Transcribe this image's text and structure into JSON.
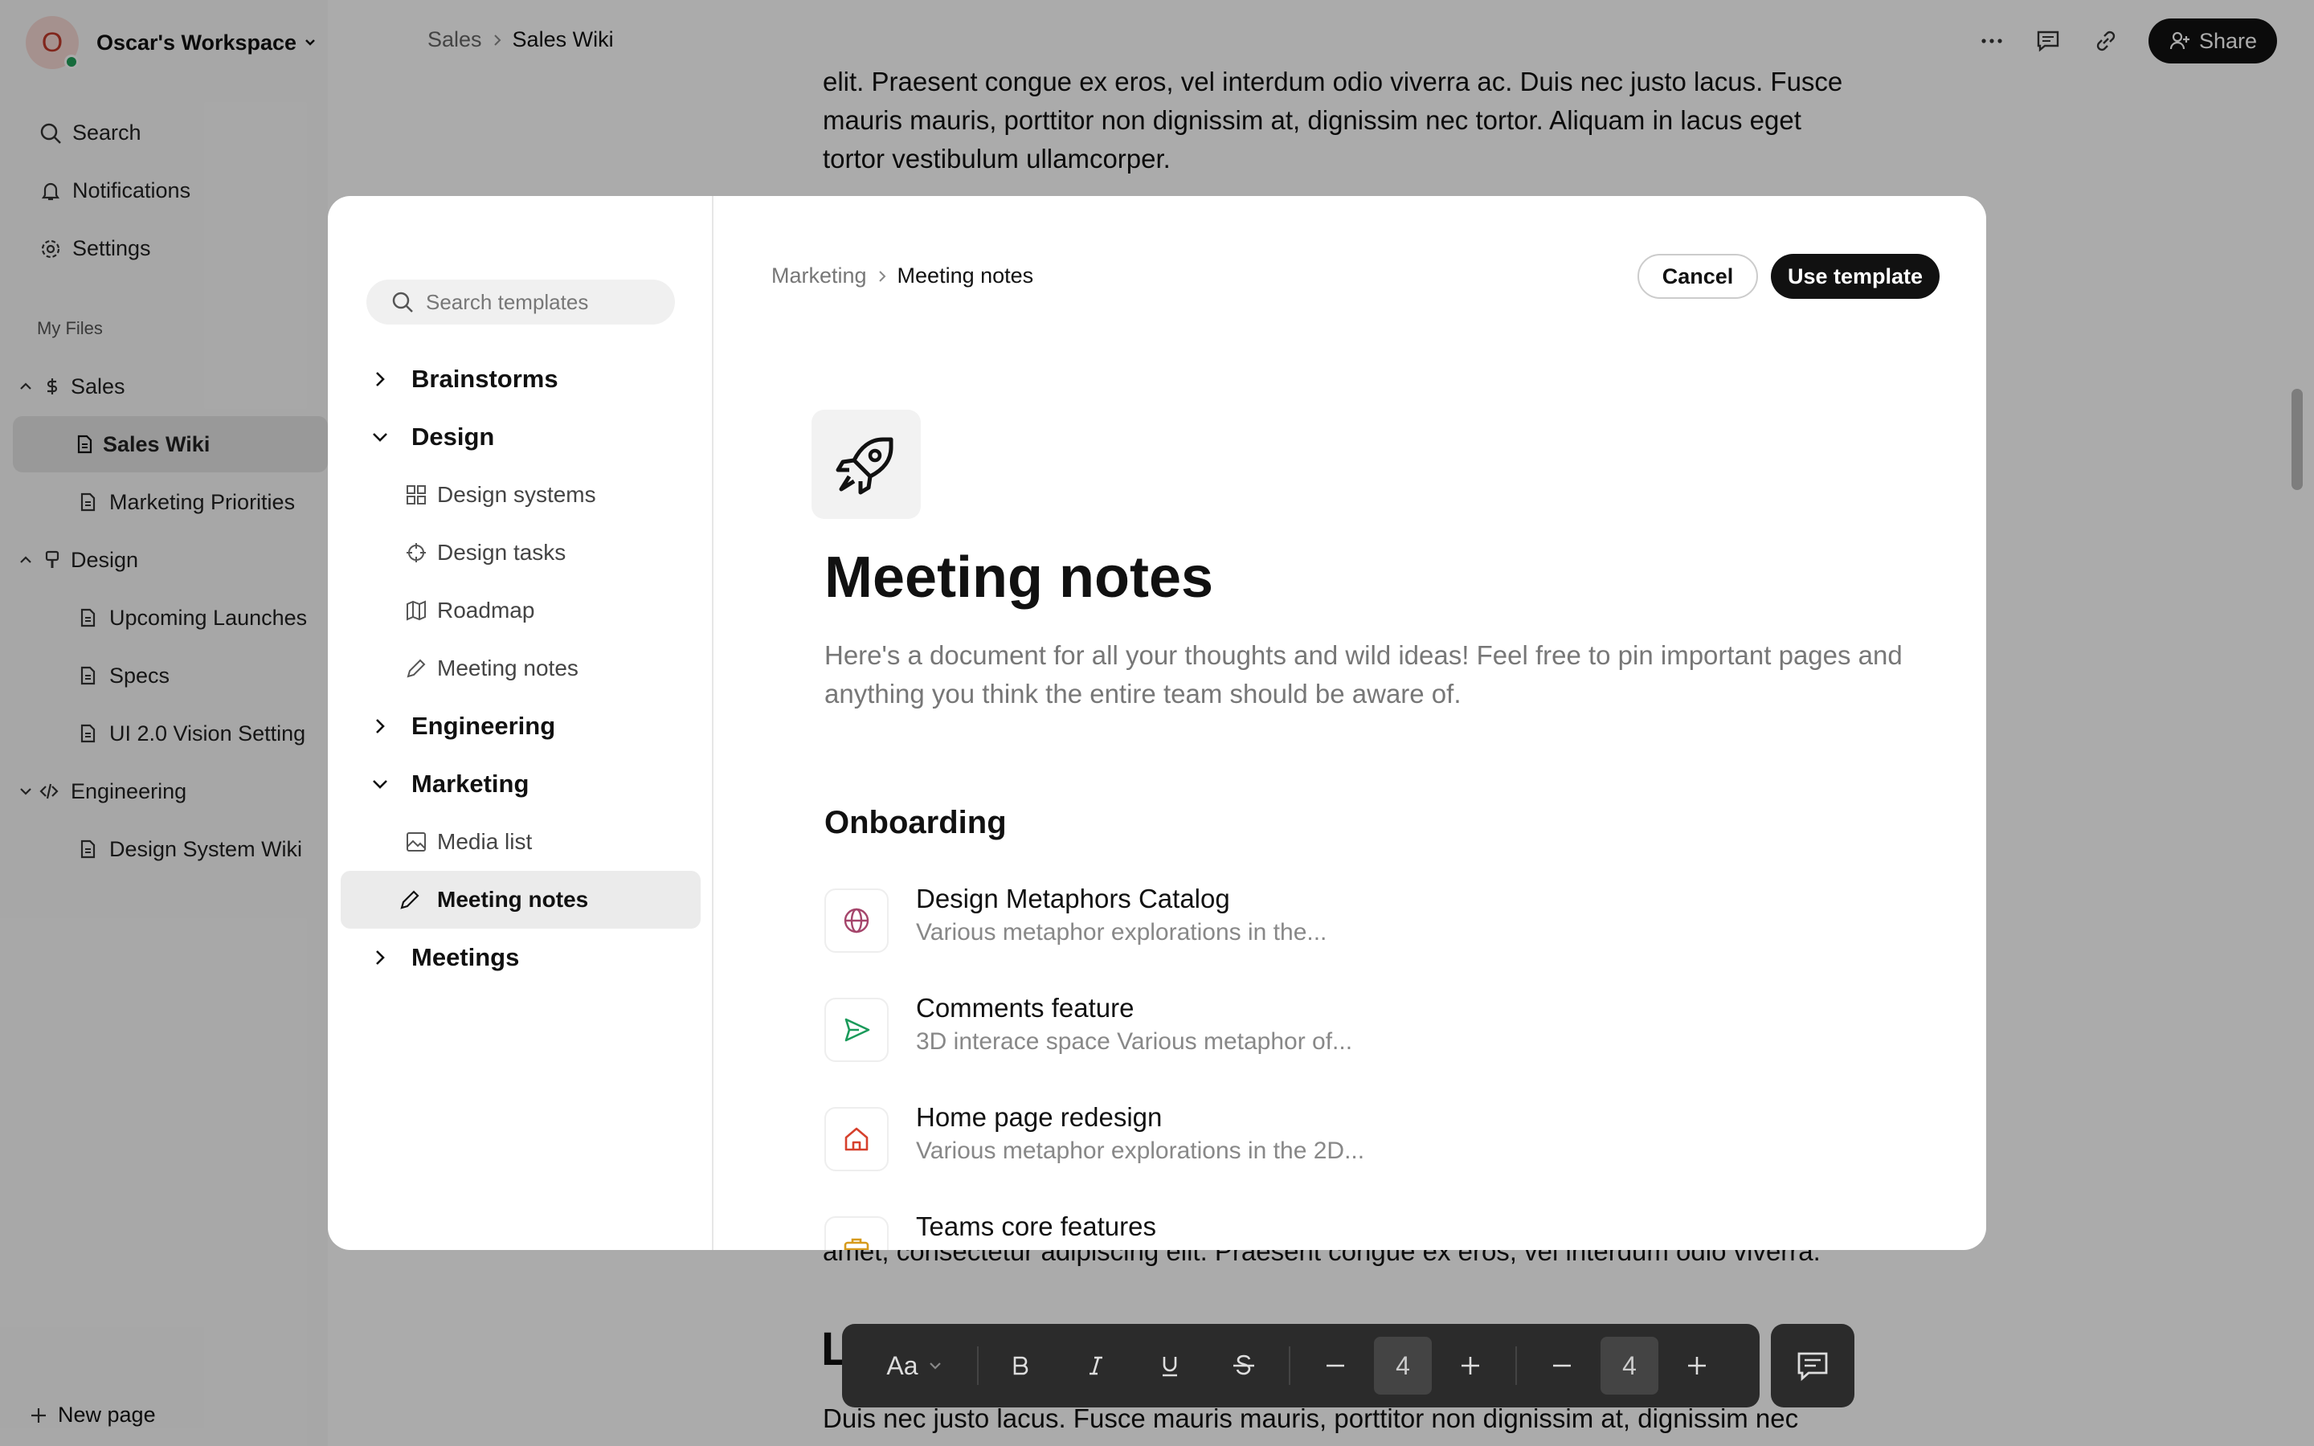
{
  "workspace": {
    "initial": "O",
    "name": "Oscar's Workspace"
  },
  "topbar": {
    "crumb_parent": "Sales",
    "crumb_current": "Sales Wiki",
    "share_label": "Share"
  },
  "sidebar": {
    "search": "Search",
    "notifications": "Notifications",
    "settings": "Settings",
    "section": "My Files",
    "tree": [
      {
        "label": "Sales"
      },
      {
        "label": "Sales Wiki"
      },
      {
        "label": "Marketing Priorities"
      },
      {
        "label": "Design"
      },
      {
        "label": "Upcoming Launches"
      },
      {
        "label": "Specs"
      },
      {
        "label": "UI 2.0 Vision Setting"
      },
      {
        "label": "Engineering"
      },
      {
        "label": "Design System Wiki"
      }
    ],
    "new_page": "New page"
  },
  "doc": {
    "p1": "elit. Praesent congue ex eros, vel interdum odio viverra ac. Duis nec justo lacus. Fusce",
    "p2": "mauris mauris, porttitor non dignissim at, dignissim nec tortor. Aliquam in lacus eget",
    "p3": "tortor vestibulum ullamcorper.",
    "p4": "amet, consectetur adipiscing elit. Praesent congue ex eros, vel interdum odio viverra.",
    "heading": "L",
    "p5": "Duis nec justo lacus. Fusce mauris mauris, porttitor non dignissim at, dignissim nec"
  },
  "modal": {
    "search_placeholder": "Search templates",
    "categories": [
      {
        "label": "Brainstorms"
      },
      {
        "label": "Design"
      },
      {
        "label": "Design systems"
      },
      {
        "label": "Design tasks"
      },
      {
        "label": "Roadmap"
      },
      {
        "label": "Meeting notes"
      },
      {
        "label": "Engineering"
      },
      {
        "label": "Marketing"
      },
      {
        "label": "Media list"
      },
      {
        "label": "Meeting notes"
      },
      {
        "label": "Meetings"
      }
    ],
    "crumb_parent": "Marketing",
    "crumb_current": "Meeting notes",
    "cancel_label": "Cancel",
    "use_label": "Use template",
    "title": "Meeting notes",
    "description": "Here's a document for all your thoughts and wild ideas! Feel free to pin important pages and anything you think the entire team should be aware of.",
    "section": "Onboarding",
    "cards": [
      {
        "title": "Design Metaphors Catalog",
        "desc": "Various metaphor explorations in the...",
        "icon": "globe-icon",
        "color": "#a5456b"
      },
      {
        "title": "Comments feature",
        "desc": "3D interace space Various metaphor of...",
        "icon": "send-icon",
        "color": "#1a9a5a"
      },
      {
        "title": "Home page redesign",
        "desc": "Various metaphor explorations in the 2D...",
        "icon": "home-icon",
        "color": "#d6402c"
      },
      {
        "title": "Teams core features",
        "desc": "",
        "icon": "briefcase-icon",
        "color": "#d69a1c"
      }
    ]
  },
  "toolbar": {
    "font_label": "Aa",
    "num1": "4",
    "num2": "4"
  }
}
